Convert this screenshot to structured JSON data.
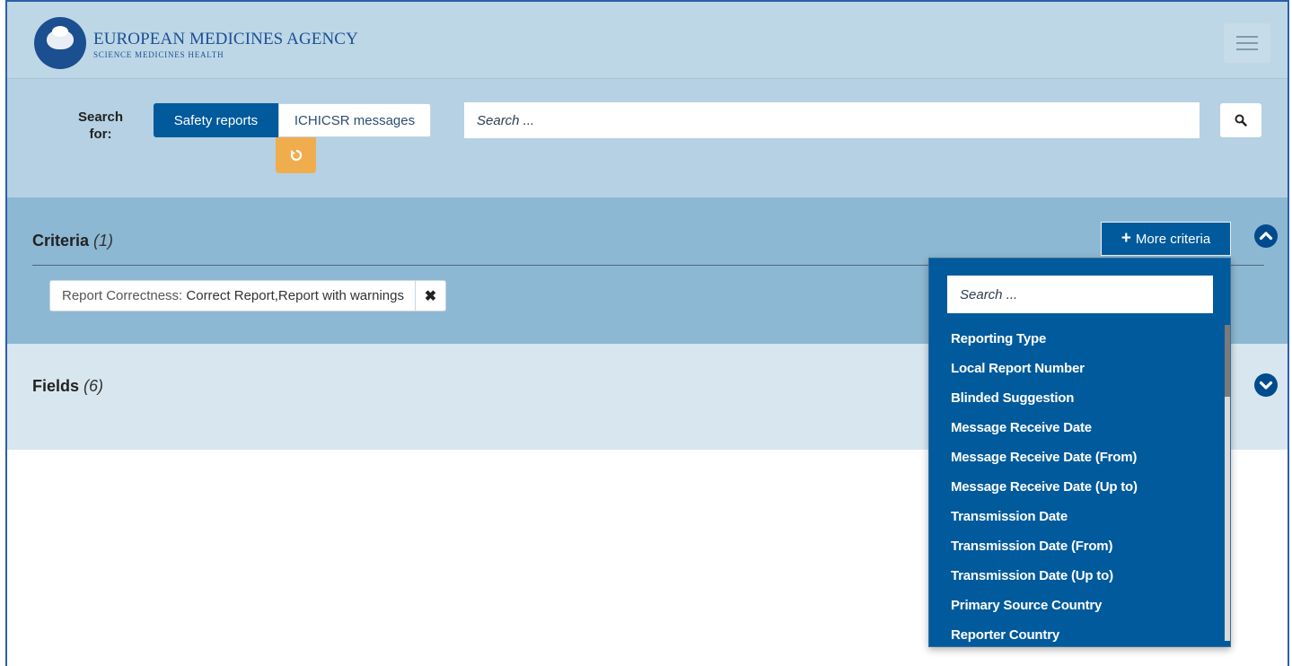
{
  "header": {
    "agency_name": "EUROPEAN MEDICINES AGENCY",
    "agency_tagline": "SCIENCE   MEDICINES   HEALTH"
  },
  "search": {
    "label": "Search for:",
    "tabs": [
      "Safety reports",
      "ICHICSR messages"
    ],
    "active_tab": "Safety reports",
    "placeholder": "Search ..."
  },
  "criteria": {
    "title": "Criteria",
    "count": "(1)",
    "more_button": "More criteria",
    "chips": [
      {
        "label": "Report Correctness:",
        "value": "Correct Report,Report with warnings"
      }
    ]
  },
  "fields": {
    "title": "Fields",
    "count": "(6)"
  },
  "dropdown": {
    "search_placeholder": "Search ...",
    "items": [
      "Reporting Type",
      "Local Report Number",
      "Blinded Suggestion",
      "Message Receive Date",
      "Message Receive Date (From)",
      "Message Receive Date (Up to)",
      "Transmission Date",
      "Transmission Date (From)",
      "Transmission Date (Up to)",
      "Primary Source Country",
      "Reporter Country"
    ]
  },
  "colors": {
    "primary": "#005a9c",
    "header_bg": "#bed7e6",
    "criteria_bg": "#8db8d3",
    "reset_button": "#f0ad4e"
  },
  "icons": [
    "ema-logo",
    "hamburger-menu-icon",
    "search-icon",
    "reset-icon",
    "plus-icon",
    "chevron-up-icon",
    "chevron-down-icon",
    "close-icon"
  ]
}
